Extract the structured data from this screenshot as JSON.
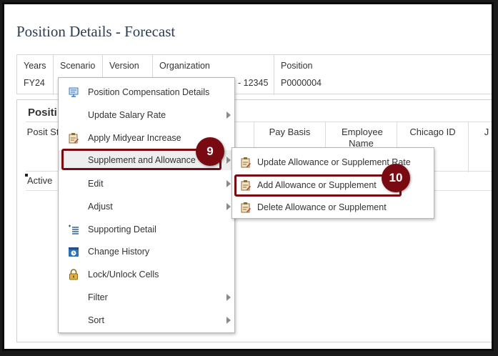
{
  "page": {
    "title": "Position Details - Forecast"
  },
  "pov": [
    {
      "label": "Years",
      "value": "FY24"
    },
    {
      "label": "Scenario",
      "value": ""
    },
    {
      "label": "Version",
      "value": ""
    },
    {
      "label": "Organization",
      "value": "- 12345"
    },
    {
      "label": "Position",
      "value": "P0000004"
    }
  ],
  "panel": {
    "title": "Positi"
  },
  "grid": {
    "headers": [
      "Posit Stat",
      "",
      "Pay Basis",
      "Employee Name",
      "Chicago ID",
      "J"
    ],
    "rows": [
      {
        "status": "Active"
      }
    ]
  },
  "context_menu": {
    "items": [
      {
        "label": "Position Compensation Details",
        "icon": "position-compensation-icon",
        "submenu": false
      },
      {
        "label": "Update Salary Rate",
        "icon": "",
        "submenu": true
      },
      {
        "label": "Apply Midyear Increase",
        "icon": "clipboard-edit-icon",
        "submenu": false
      },
      {
        "label": "Supplement and Allowance",
        "icon": "",
        "submenu": true
      },
      {
        "label": "Edit",
        "icon": "",
        "submenu": true
      },
      {
        "label": "Adjust",
        "icon": "",
        "submenu": true
      },
      {
        "label": "Supporting Detail",
        "icon": "supporting-detail-icon",
        "submenu": false
      },
      {
        "label": "Change History",
        "icon": "change-history-icon",
        "submenu": false
      },
      {
        "label": "Lock/Unlock Cells",
        "icon": "lock-icon",
        "submenu": false
      },
      {
        "label": "Filter",
        "icon": "",
        "submenu": true
      },
      {
        "label": "Sort",
        "icon": "",
        "submenu": true
      }
    ]
  },
  "submenu": {
    "items": [
      {
        "label": "Update Allowance or Supplement Rate",
        "icon": "clipboard-edit-icon"
      },
      {
        "label": "Add Allowance or Supplement",
        "icon": "clipboard-edit-icon"
      },
      {
        "label": "Delete Allowance or Supplement",
        "icon": "clipboard-edit-icon"
      }
    ]
  },
  "callouts": {
    "step9": "9",
    "step10": "10"
  },
  "colors": {
    "callout": "#7a0a12",
    "title": "#2d3e50",
    "menu_highlight": "#eeeeee"
  }
}
